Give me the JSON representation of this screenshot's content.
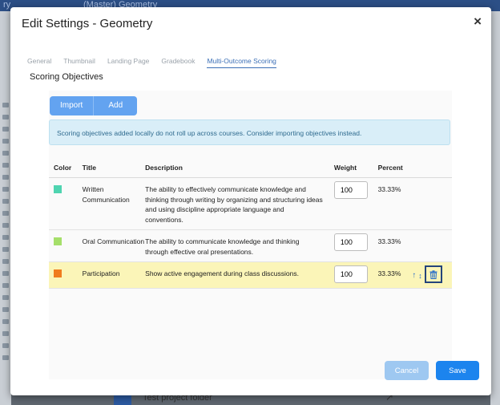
{
  "background": {
    "top_text_1": "ry",
    "top_text_2": "(Master) Geometry",
    "bottom_text": "Test project folder"
  },
  "modal": {
    "title": "Edit Settings - Geometry",
    "close_label": "×",
    "tabs": [
      {
        "label": "General",
        "active": false
      },
      {
        "label": "Thumbnail",
        "active": false
      },
      {
        "label": "Landing Page",
        "active": false
      },
      {
        "label": "Gradebook",
        "active": false
      },
      {
        "label": "Multi-Outcome Scoring",
        "active": true
      }
    ],
    "section_title": "Scoring Objectives",
    "buttons": {
      "import": "Import",
      "add": "Add",
      "cancel": "Cancel",
      "save": "Save"
    },
    "info_message": "Scoring objectives added locally do not roll up across courses. Consider importing objectives instead.",
    "table": {
      "headers": {
        "color": "Color",
        "title": "Title",
        "description": "Description",
        "weight": "Weight",
        "percent": "Percent"
      },
      "rows": [
        {
          "color": "#4fd4b0",
          "title": "Written Communication",
          "description": "The ability to effectively communicate knowledge and thinking through writing by organizing and structuring ideas and using discipline appropriate language and conventions.",
          "weight": "100",
          "percent": "33.33%"
        },
        {
          "color": "#a5df6a",
          "title": "Oral Communication",
          "description": "The ability to communicate knowledge and thinking through effective oral presentations.",
          "weight": "100",
          "percent": "33.33%"
        },
        {
          "color": "#f07c1e",
          "title": "Participation",
          "description": "Show active engagement during class discussions.",
          "weight": "100",
          "percent": "33.33%"
        }
      ]
    }
  }
}
